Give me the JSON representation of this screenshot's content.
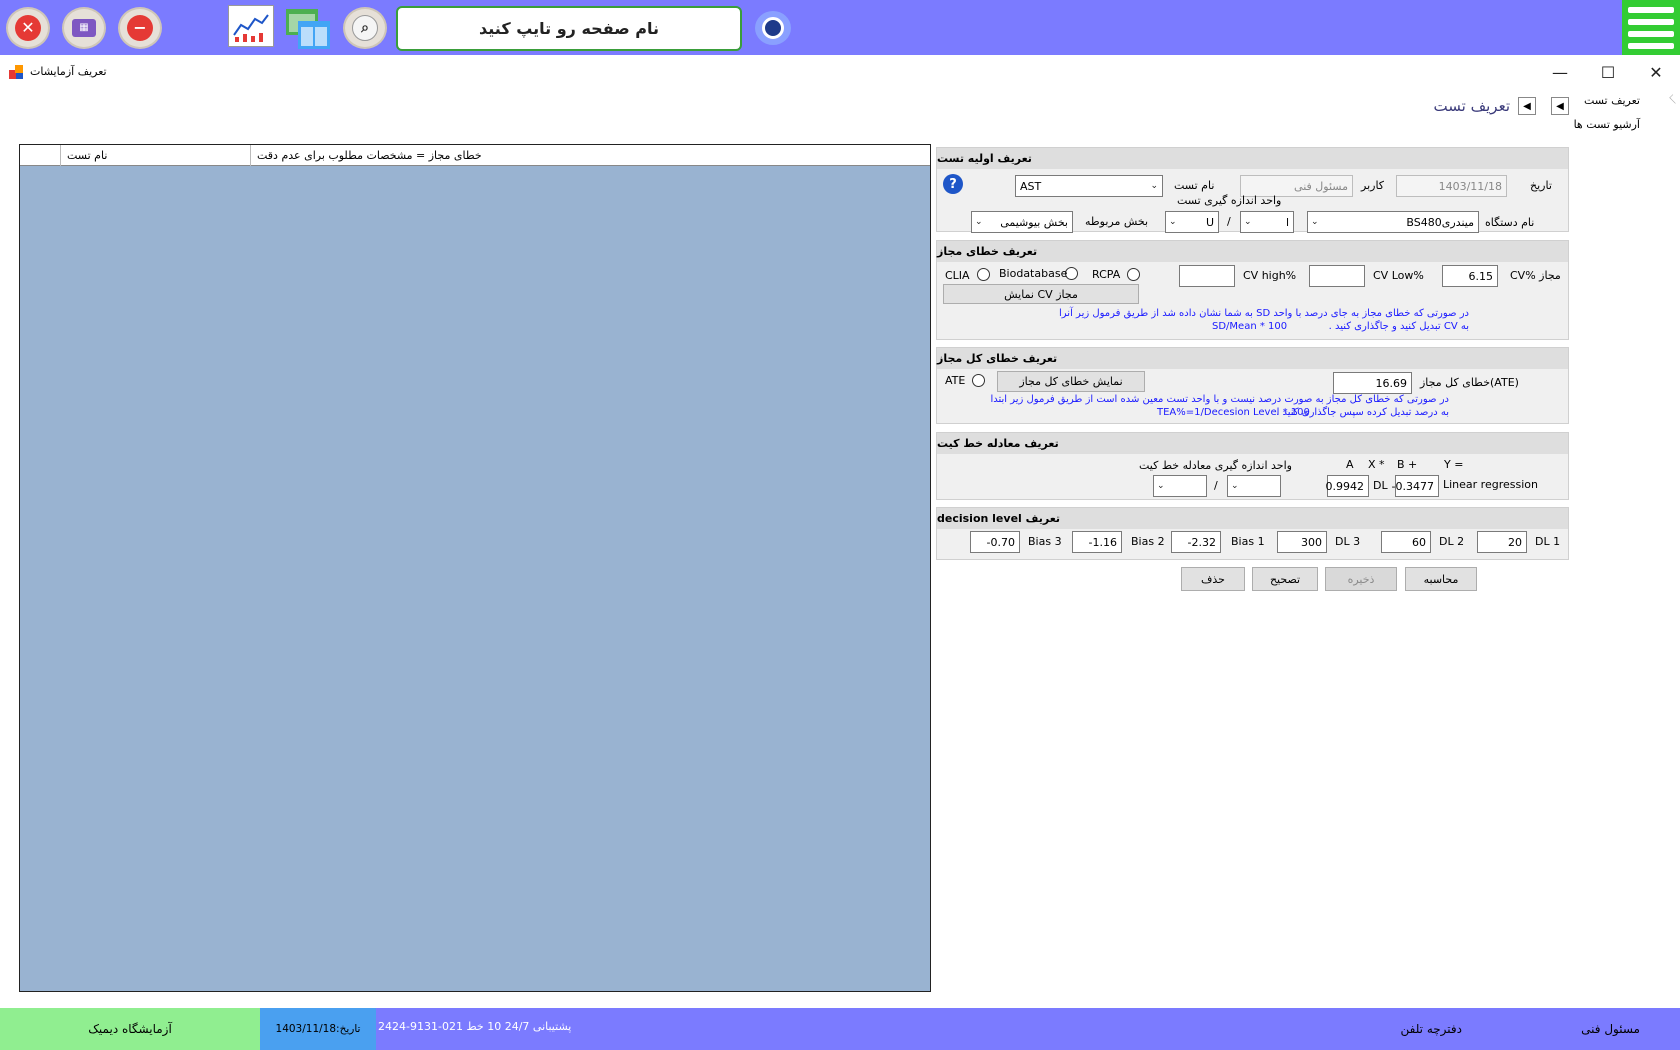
{
  "topbar": {
    "search_placeholder": "نام صفحه رو تایپ کنید",
    "icons": [
      "close-icon",
      "monitor-icon",
      "minus-icon",
      "chart-icon",
      "windows-icon",
      "magnifier-icon",
      "eye-icon",
      "menu-icon"
    ]
  },
  "window": {
    "title": "تعریف آزمایشات",
    "minimize": "—",
    "maximize": "☐",
    "close": "✕"
  },
  "nav": {
    "items": [
      "تعریف تست",
      "آرشیو تست ها"
    ],
    "page_title": "تعریف تست"
  },
  "grid": {
    "columns": [
      "",
      "نام تست",
      "خطای مجاز = مشخصات مطلوب برای عدم دقت"
    ]
  },
  "basic": {
    "header": "تعریف اولیه تست",
    "date_label": "تاریخ",
    "date_value": "1403/11/18",
    "user_label": "کاربر",
    "user_value": "مسئول فنی",
    "test_name_label": "نام تست",
    "test_name_value": "AST",
    "unit_label": "واحد اندازه گیری تست",
    "device_label": "نام دستگاه",
    "device_value": "BS480میندری",
    "unit_num": "l",
    "unit_den": "U",
    "slash": "/",
    "section_label": "بخش مربوطه",
    "section_value": "بخش بیوشیمی"
  },
  "allowable": {
    "header": "تعریف خطای مجاز",
    "cv_label": "CV% مجاز",
    "cv_value": "6.15",
    "cv_low_label": "CV Low%",
    "cv_low_value": "",
    "cv_high_label": "CV high%",
    "cv_high_value": "",
    "rcpa": "RCPA",
    "biodatabase": "Biodatabase",
    "clia": "CLIA",
    "show_cv_button": "نمایش CV مجاز",
    "note_line1": "در صورتی که خطای مجاز به جای درصد با واحد SD به شما نشان داده شد از طریق فرمول زیر آنرا",
    "note_line2": "به CV تبدیل کنید و جاگذاری کنید .",
    "formula": "SD/Mean * 100"
  },
  "total": {
    "header": "تعریف خطای کل مجاز",
    "ate_label": "خطای کل مجاز(ATE)",
    "ate_value": "16.69",
    "show_button": "نمایش خطای کل مجاز",
    "ate_radio": "ATE",
    "note_line1": "در صورتی که خطای کل مجاز به صورت درصد نیست و با واحد تست معین شده است از طریق فرمول زیر ابتدا",
    "note_line2": "به درصد تبدیل کرده سپس جاگذاری کنید .",
    "formula": "TEA%=1/Decesion Level * 100"
  },
  "regression": {
    "header": "تعریف معادله خط کیت",
    "eq_y": "Y =",
    "eq_b": "B +",
    "eq_x": "X *",
    "eq_a": "A",
    "unit_label": "واحد اندازه گیری معادله خط کیت",
    "lr_label": "Linear regression",
    "b_value": "-0.3477",
    "dl_label": "DL",
    "a_value": "0.9942",
    "slash": "/"
  },
  "decision": {
    "header": "تعریف decision level",
    "dl1_label": "DL 1",
    "dl1": "20",
    "dl2_label": "DL 2",
    "dl2": "60",
    "dl3_label": "DL 3",
    "dl3": "300",
    "bias1_label": "Bias 1",
    "bias1": "-2.32",
    "bias2_label": "Bias 2",
    "bias2": "-1.16",
    "bias3_label": "Bias 3",
    "bias3": "-0.70"
  },
  "actions": {
    "calculate": "محاسبه",
    "save": "ذخیره",
    "edit": "تصحیح",
    "delete": "حذف"
  },
  "footer": {
    "tech": "مسئول فنی",
    "phonebook": "دفترچه تلفن",
    "support": "پشتیبانی 24/7   10 خط  021-9131-2424",
    "date": "تاریخ:1403/11/18",
    "lab": "آزمایشگاه دیمیک"
  }
}
